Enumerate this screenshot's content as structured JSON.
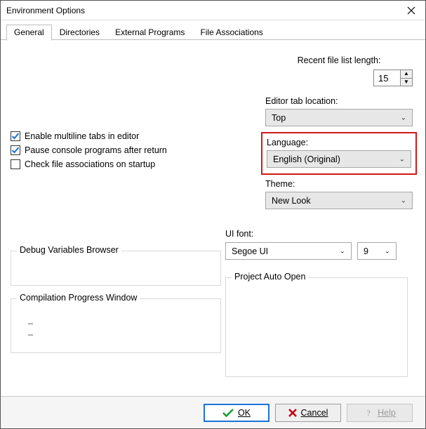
{
  "window": {
    "title": "Environment Options"
  },
  "tabs": [
    "General",
    "Directories",
    "External Programs",
    "File Associations"
  ],
  "active_tab": 0,
  "right": {
    "recent_label": "Recent file list length:",
    "recent_value": "15",
    "editor_tab_label": "Editor tab location:",
    "editor_tab_value": "Top",
    "language_label": "Language:",
    "language_value": "English (Original)",
    "theme_label": "Theme:",
    "theme_value": "New Look"
  },
  "checks": {
    "multiline": {
      "label": "Enable multiline tabs in editor",
      "checked": true
    },
    "pause": {
      "label": "Pause console programs after return",
      "checked": true
    },
    "assoc": {
      "label": "Check file associations on startup",
      "checked": false
    }
  },
  "ui_font": {
    "label": "UI font:",
    "family": "Segoe UI",
    "size": "9"
  },
  "groups": {
    "debug": "Debug Variables Browser",
    "compile": "Compilation Progress Window",
    "dash1": "_",
    "dash2": "_",
    "auto": "Project Auto Open"
  },
  "buttons": {
    "ok": "OK",
    "cancel": "Cancel",
    "help": "Help"
  }
}
